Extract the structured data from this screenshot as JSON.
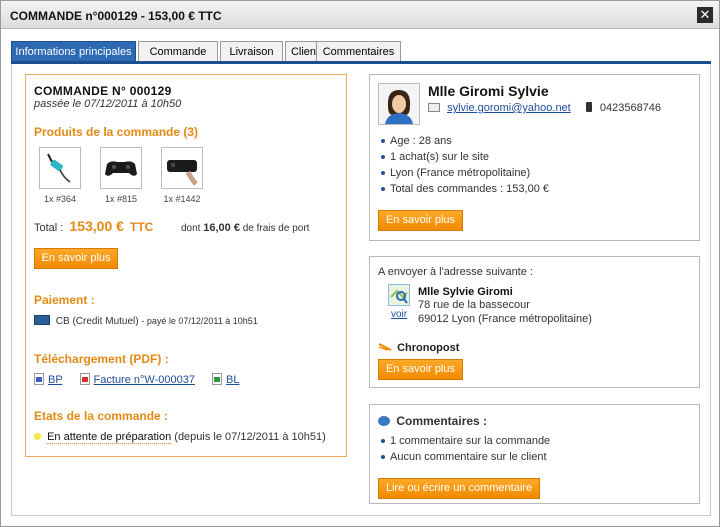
{
  "window": {
    "title": "COMMANDE n°000129 - 153,00 €  TTC",
    "close_glyph": "✕"
  },
  "tabs": [
    "Informations principales",
    "Commande",
    "Livraison",
    "Client",
    "Commentaires"
  ],
  "order": {
    "heading": "COMMANDE N° 000129",
    "date_prefix": "passée le",
    "date": "07/12/2011 à 10h50",
    "products_heading": "Produits de la commande (3)",
    "products": [
      {
        "label": "1x #364",
        "icon": "usb-lamp-icon"
      },
      {
        "label": "1x #815",
        "icon": "gamepad-icon"
      },
      {
        "label": "1x #1442",
        "icon": "mouse-icon"
      }
    ],
    "total_label": "Total :",
    "total_value": "153,00 €",
    "total_suffix": "TTC",
    "shipping_prefix": "dont",
    "shipping_value": "16,00 €",
    "shipping_suffix": "de frais de port",
    "more_button": "En savoir plus",
    "payment_heading": "Paiement :",
    "payment_method": "CB (Credit Mutuel)",
    "payment_detail": "- payé le 07/12/2011 à 10h51",
    "download_heading": "Téléchargement (PDF) :",
    "downloads": [
      "BP",
      "Facture n°W-000037",
      "BL"
    ],
    "states_heading": "Etats de la commande :",
    "state_link": "En attente de préparation",
    "state_detail": "(depuis le 07/12/2011 à 10h51)",
    "state_color": "#f5e642"
  },
  "customer": {
    "name": "Mlle Giromi Sylvie",
    "email": "sylvie.goromi@yahoo.net",
    "phone": "0423568746",
    "details": [
      "Age : 28 ans",
      "1 achat(s) sur le site",
      "Lyon (France métropolitaine)",
      "Total des commandes : 153,00 €"
    ],
    "more_button": "En savoir plus"
  },
  "shipping": {
    "intro": "A envoyer à l'adresse suivante :",
    "map_link": "voir",
    "name": "Mlle Sylvie Giromi",
    "street": "78 rue de la bassecour",
    "city": "69012 Lyon (France métropolitaine)",
    "carrier": "Chronopost",
    "more_button": "En savoir plus"
  },
  "comments": {
    "heading": "Commentaires :",
    "items": [
      "1 commentaire sur la commande",
      "Aucun commentaire sur le client"
    ],
    "button": "Lire ou écrire un commentaire"
  },
  "colors": {
    "accent_orange": "#f5920a",
    "tab_blue": "#2d6ab3",
    "heading_orange": "#e38a14",
    "link_blue": "#1f4e9a"
  }
}
